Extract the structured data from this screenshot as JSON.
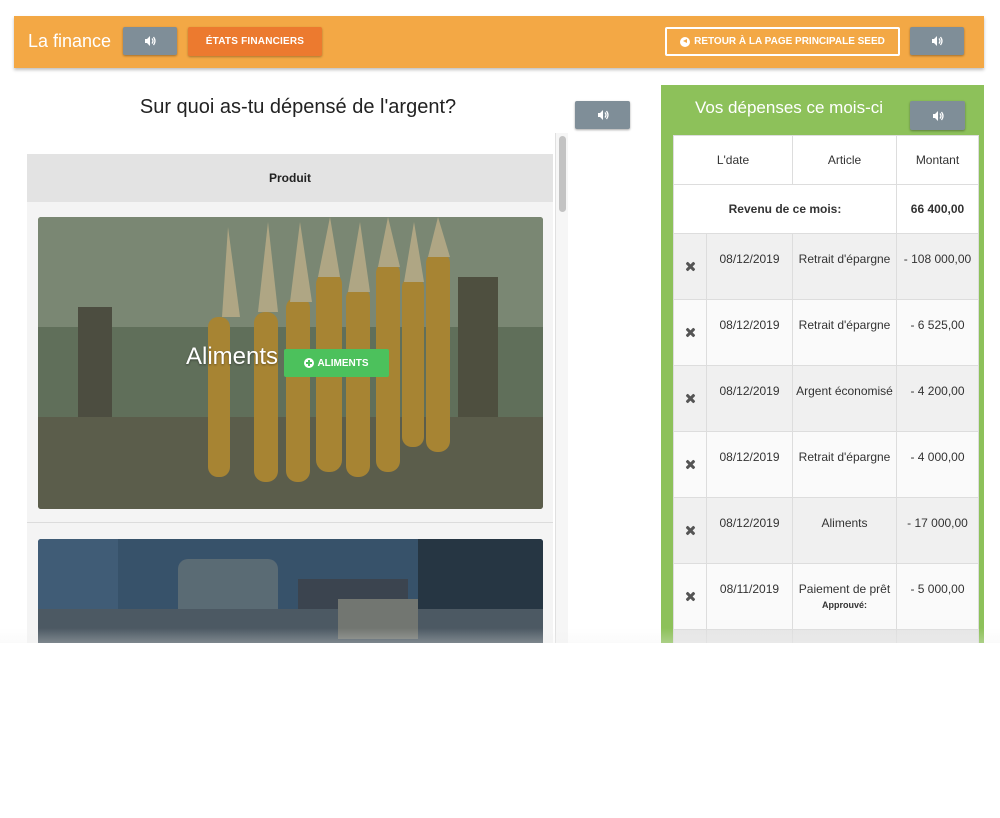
{
  "header": {
    "title": "La finance",
    "etats_label": "ÉTATS FINANCIERS",
    "retour_label": "RETOUR À LA PAGE PRINCIPALE SEED"
  },
  "left_panel": {
    "heading": "Sur quoi as-tu dépensé de l'argent?",
    "column_header": "Produit",
    "cards": [
      {
        "label": "Aliments",
        "button": "ALIMENTS"
      }
    ]
  },
  "right_panel": {
    "heading": "Vos dépenses ce mois-ci",
    "columns": [
      "L'date",
      "Article",
      "Montant"
    ],
    "revenue_label": "Revenu de ce mois:",
    "revenue_value": "66 400,00",
    "rows": [
      {
        "date": "08/12/2019",
        "article": "Retrait d'épargne",
        "amount": "- 108 000,00",
        "status": ""
      },
      {
        "date": "08/12/2019",
        "article": "Retrait d'épargne",
        "amount": "- 6 525,00",
        "status": ""
      },
      {
        "date": "08/12/2019",
        "article": "Argent économisé",
        "amount": "- 4 200,00",
        "status": ""
      },
      {
        "date": "08/12/2019",
        "article": "Retrait d'épargne",
        "amount": "- 4 000,00",
        "status": ""
      },
      {
        "date": "08/12/2019",
        "article": "Aliments",
        "amount": "- 17 000,00",
        "status": ""
      },
      {
        "date": "08/11/2019",
        "article": "Paiement de prêt",
        "amount": "- 5 000,00",
        "status": "Approuvé:"
      }
    ]
  },
  "icons": {
    "speaker": "speaker-icon",
    "back": "arrow-left-circle-icon",
    "add": "plus-circle-icon",
    "delete": "close-icon"
  },
  "colors": {
    "header_bg": "#f3a845",
    "etats_btn": "#ec7a2f",
    "speaker_btn": "#7f8e98",
    "right_panel_bg": "#8dc15a",
    "add_btn": "#4cc15c"
  }
}
